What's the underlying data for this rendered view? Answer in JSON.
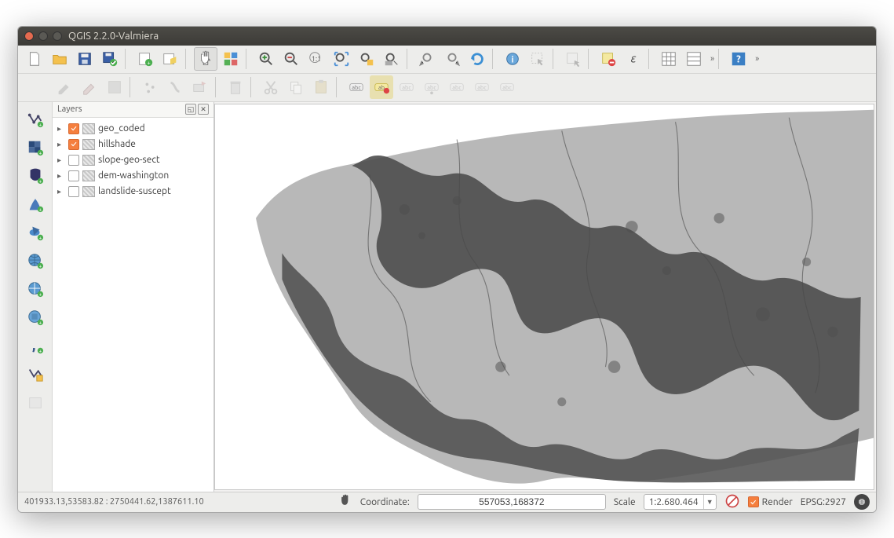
{
  "window": {
    "title": "QGIS 2.2.0-Valmiera"
  },
  "panels": {
    "layers": {
      "title": "Layers",
      "items": [
        {
          "label": "geo_coded",
          "checked": true
        },
        {
          "label": "hillshade",
          "checked": true
        },
        {
          "label": "slope-geo-sect",
          "checked": false
        },
        {
          "label": "dem-washington",
          "checked": false
        },
        {
          "label": "landslide-suscept",
          "checked": false
        }
      ]
    }
  },
  "status": {
    "extent": "401933.13,53583.82 : 2750441.62,1387611.10",
    "coord_label": "Coordinate:",
    "coord_value": "557053,168372",
    "scale_label": "Scale",
    "scale_value": "1:2.680.464",
    "render_label": "Render",
    "crs_label": "EPSG:2927"
  }
}
